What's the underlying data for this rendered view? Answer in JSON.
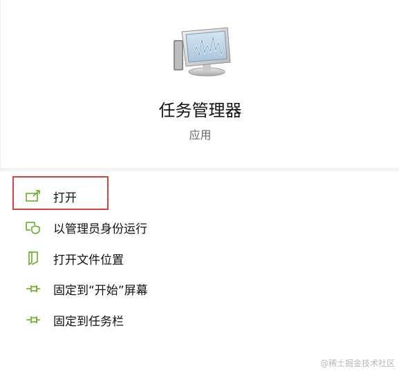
{
  "app": {
    "title": "任务管理器",
    "subtitle": "应用"
  },
  "menu": {
    "items": [
      {
        "label": "打开",
        "icon": "open-external-icon"
      },
      {
        "label": "以管理员身份运行",
        "icon": "shield-admin-icon"
      },
      {
        "label": "打开文件位置",
        "icon": "file-location-icon"
      },
      {
        "label": "固定到“开始”屏幕",
        "icon": "pin-icon"
      },
      {
        "label": "固定到任务栏",
        "icon": "pin-icon"
      }
    ]
  },
  "watermark": "@稀土掘金技术社区",
  "colors": {
    "icon_green": "#5fa818",
    "highlight_red": "#d94040"
  }
}
